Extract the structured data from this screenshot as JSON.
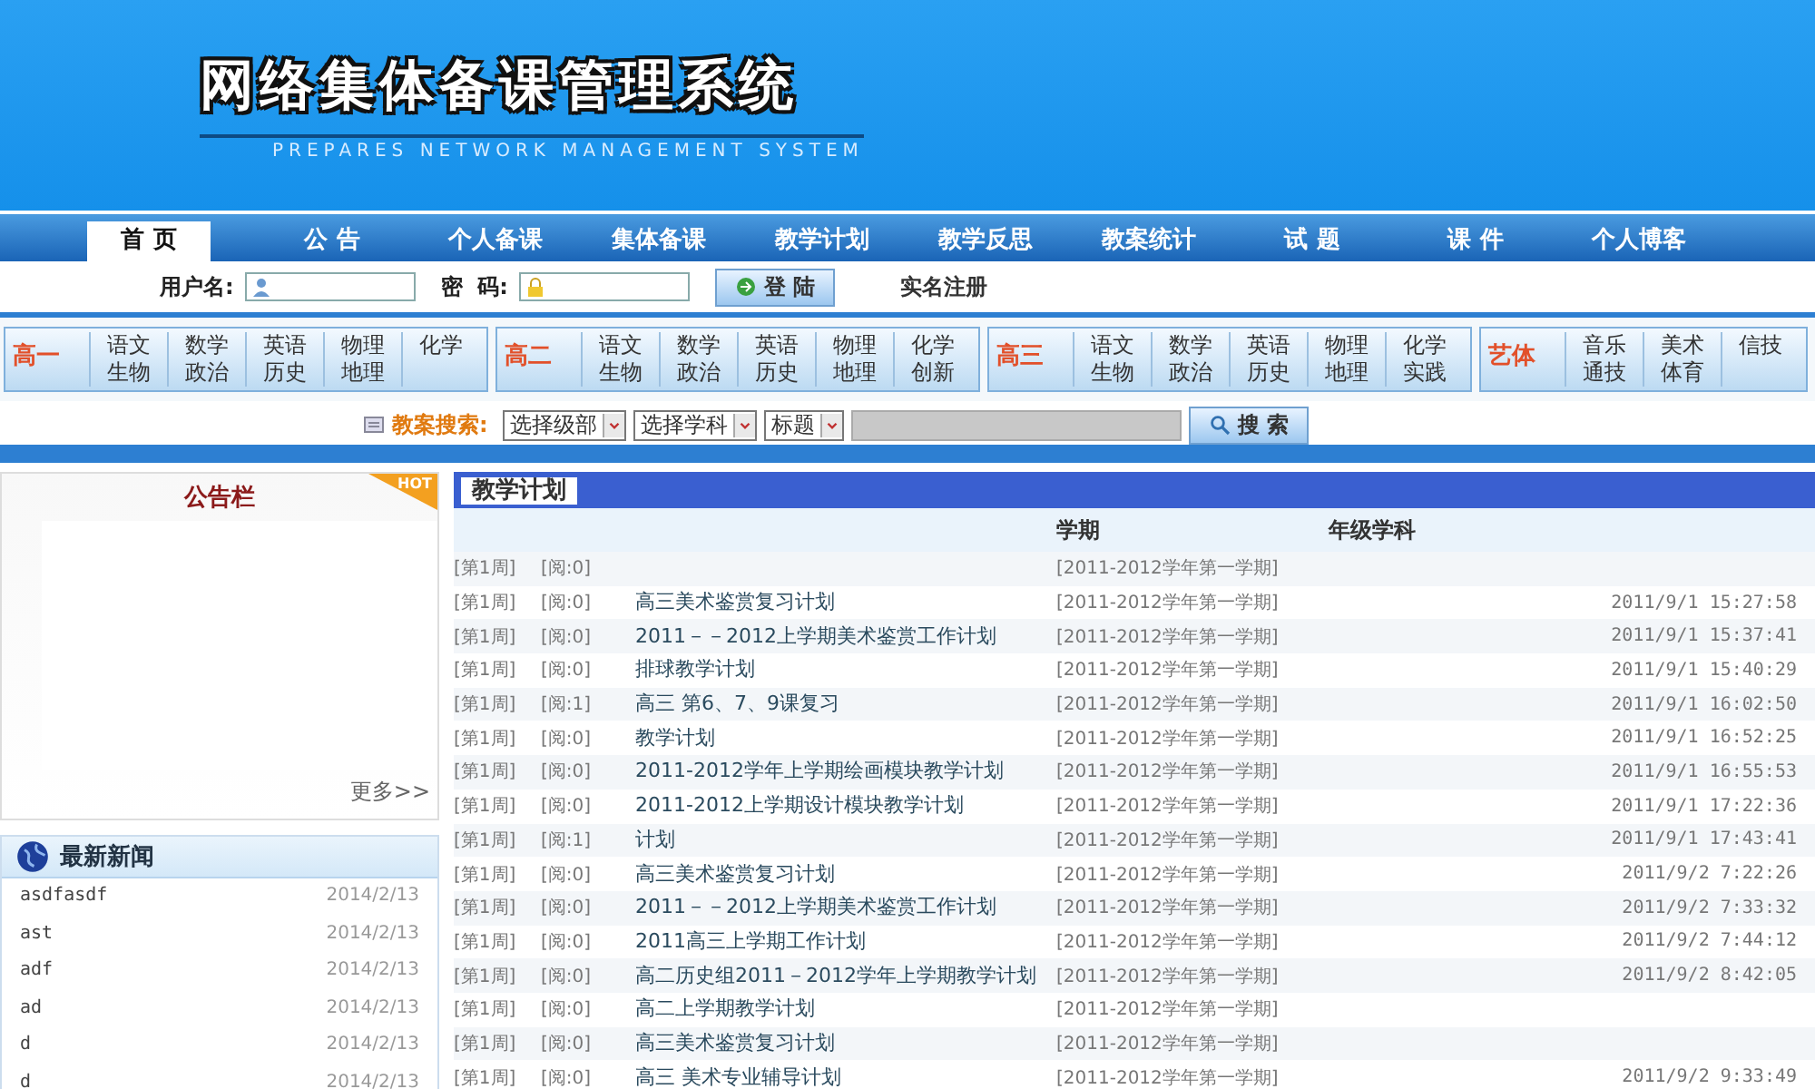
{
  "logo": {
    "title": "网络集体备课管理系统",
    "subtitle": "PREPARES NETWORK MANAGEMENT SYSTEM"
  },
  "nav": [
    {
      "label": "首 页",
      "selected": true
    },
    {
      "label": "公 告",
      "selected": false
    },
    {
      "label": "个人备课",
      "selected": false
    },
    {
      "label": "集体备课",
      "selected": false
    },
    {
      "label": "教学计划",
      "selected": false
    },
    {
      "label": "教学反思",
      "selected": false
    },
    {
      "label": "教案统计",
      "selected": false
    },
    {
      "label": "试 题",
      "selected": false
    },
    {
      "label": "课 件",
      "selected": false
    },
    {
      "label": "个人博客",
      "selected": false
    }
  ],
  "login": {
    "username_label": "用户名:",
    "password_label": "密  码:",
    "login_button": "登 陆",
    "register_link": "实名注册"
  },
  "grades": [
    {
      "label": "高一",
      "subjects": [
        [
          "语文",
          "生物"
        ],
        [
          "数学",
          "政治"
        ],
        [
          "英语",
          "历史"
        ],
        [
          "物理",
          "地理"
        ],
        [
          "化学"
        ]
      ]
    },
    {
      "label": "高二",
      "subjects": [
        [
          "语文",
          "生物"
        ],
        [
          "数学",
          "政治"
        ],
        [
          "英语",
          "历史"
        ],
        [
          "物理",
          "地理"
        ],
        [
          "化学",
          "创新"
        ]
      ]
    },
    {
      "label": "高三",
      "subjects": [
        [
          "语文",
          "生物"
        ],
        [
          "数学",
          "政治"
        ],
        [
          "英语",
          "历史"
        ],
        [
          "物理",
          "地理"
        ],
        [
          "化学",
          "实践"
        ]
      ]
    },
    {
      "label": "艺体",
      "subjects": [
        [
          "音乐",
          "通技"
        ],
        [
          "美术",
          "体育"
        ],
        [
          "信技"
        ]
      ]
    }
  ],
  "search": {
    "label": "教案搜索:",
    "selects": [
      "选择级部",
      "选择学科",
      "标题"
    ],
    "button": "搜 索"
  },
  "notice": {
    "title": "公告栏",
    "badge": "HOT",
    "more": "更多>>"
  },
  "news": {
    "title": "最新新闻",
    "items": [
      {
        "title": "asdfasdf",
        "date": "2014/2/13"
      },
      {
        "title": "ast",
        "date": "2014/2/13"
      },
      {
        "title": "adf",
        "date": "2014/2/13"
      },
      {
        "title": "ad",
        "date": "2014/2/13"
      },
      {
        "title": "d",
        "date": "2014/2/13"
      },
      {
        "title": "d",
        "date": "2014/2/13"
      }
    ]
  },
  "plan": {
    "title": "教学计划",
    "columns": [
      "学期",
      "年级学科"
    ],
    "rows": [
      {
        "week": "[第1周]",
        "reads": "[阅:0]",
        "term": "[2011-2012学年第一学期]"
      },
      {
        "week": "[第1周]",
        "reads": "[阅:0]",
        "title": "高三美术鉴赏复习计划",
        "term": "[2011-2012学年第一学期]",
        "time": "2011/9/1 15:27:58"
      },
      {
        "week": "[第1周]",
        "reads": "[阅:0]",
        "title": "2011－－2012上学期美术鉴赏工作计划",
        "term": "[2011-2012学年第一学期]",
        "time": "2011/9/1 15:37:41"
      },
      {
        "week": "[第1周]",
        "reads": "[阅:0]",
        "title": "排球教学计划",
        "term": "[2011-2012学年第一学期]",
        "time": "2011/9/1 15:40:29"
      },
      {
        "week": "[第1周]",
        "reads": "[阅:1]",
        "title": "高三 第6、7、9课复习",
        "term": "[2011-2012学年第一学期]",
        "time": "2011/9/1 16:02:50"
      },
      {
        "week": "[第1周]",
        "reads": "[阅:0]",
        "title": "教学计划",
        "term": "[2011-2012学年第一学期]",
        "time": "2011/9/1 16:52:25"
      },
      {
        "week": "[第1周]",
        "reads": "[阅:0]",
        "title": "2011-2012学年上学期绘画模块教学计划",
        "term": "[2011-2012学年第一学期]",
        "time": "2011/9/1 16:55:53"
      },
      {
        "week": "[第1周]",
        "reads": "[阅:0]",
        "title": "2011-2012上学期设计模块教学计划",
        "term": "[2011-2012学年第一学期]",
        "time": "2011/9/1 17:22:36"
      },
      {
        "week": "[第1周]",
        "reads": "[阅:1]",
        "title": "计划",
        "term": "[2011-2012学年第一学期]",
        "time": "2011/9/1 17:43:41"
      },
      {
        "week": "[第1周]",
        "reads": "[阅:0]",
        "title": "高三美术鉴赏复习计划",
        "term": "[2011-2012学年第一学期]",
        "time": "2011/9/2 7:22:26"
      },
      {
        "week": "[第1周]",
        "reads": "[阅:0]",
        "title": "2011－－2012上学期美术鉴赏工作计划",
        "term": "[2011-2012学年第一学期]",
        "time": "2011/9/2 7:33:32"
      },
      {
        "week": "[第1周]",
        "reads": "[阅:0]",
        "title": "2011高三上学期工作计划",
        "term": "[2011-2012学年第一学期]",
        "time": "2011/9/2 7:44:12"
      },
      {
        "week": "[第1周]",
        "reads": "[阅:0]",
        "title": "高二历史组2011－2012学年上学期教学计划",
        "term": "[2011-2012学年第一学期]",
        "time": "2011/9/2 8:42:05"
      },
      {
        "week": "[第1周]",
        "reads": "[阅:0]",
        "title": "高二上学期教学计划",
        "term": "[2011-2012学年第一学期]"
      },
      {
        "week": "[第1周]",
        "reads": "[阅:0]",
        "title": "高三美术鉴赏复习计划",
        "term": "[2011-2012学年第一学期]"
      },
      {
        "week": "[第1周]",
        "reads": "[阅:0]",
        "title": "高三 美术专业辅导计划",
        "term": "[2011-2012学年第一学期]",
        "time": "2011/9/2 9:33:49"
      }
    ]
  }
}
